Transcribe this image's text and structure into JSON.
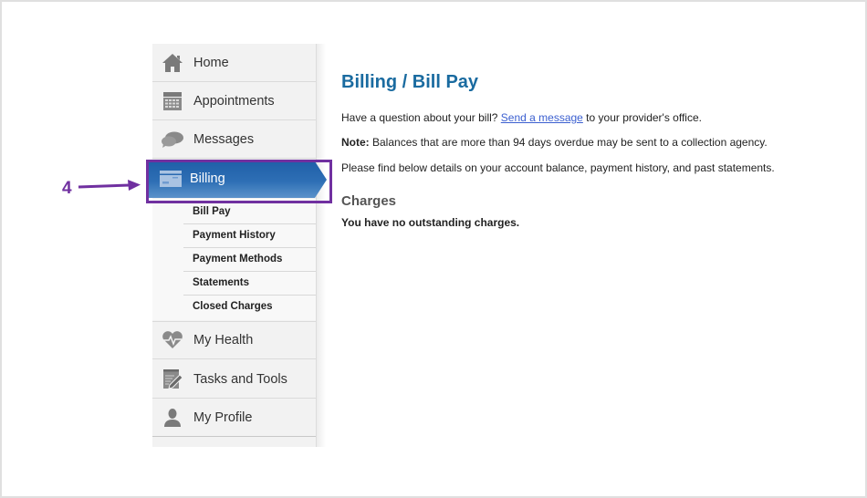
{
  "sidebar": {
    "items": [
      {
        "label": "Home",
        "icon": "home-icon"
      },
      {
        "label": "Appointments",
        "icon": "calendar-icon"
      },
      {
        "label": "Messages",
        "icon": "chat-bubbles-icon"
      },
      {
        "label": "Billing",
        "icon": "credit-card-icon",
        "active": true
      },
      {
        "label": "My Health",
        "icon": "heart-pulse-icon"
      },
      {
        "label": "Tasks and Tools",
        "icon": "notepad-pencil-icon"
      },
      {
        "label": "My Profile",
        "icon": "user-icon"
      }
    ],
    "billing_subitems": [
      {
        "label": "Bill Pay",
        "active": true
      },
      {
        "label": "Payment History"
      },
      {
        "label": "Payment Methods"
      },
      {
        "label": "Statements"
      },
      {
        "label": "Closed Charges"
      }
    ]
  },
  "annotation": {
    "step_number": "4",
    "color": "#7030a0"
  },
  "main": {
    "title": "Billing / Bill Pay",
    "question_prefix": "Have a question about your bill? ",
    "question_link": "Send a message",
    "question_suffix": " to your provider's office.",
    "note_label": "Note:",
    "note_text": " Balances that are more than 94 days overdue may be sent to a collection agency.",
    "details_text": "Please find below details on your account balance, payment history, and past statements.",
    "charges_heading": "Charges",
    "charges_text": "You have no outstanding charges."
  },
  "colors": {
    "title": "#1a6ba0",
    "active_nav": "#2e6fb5",
    "link": "#3b5fd0"
  }
}
